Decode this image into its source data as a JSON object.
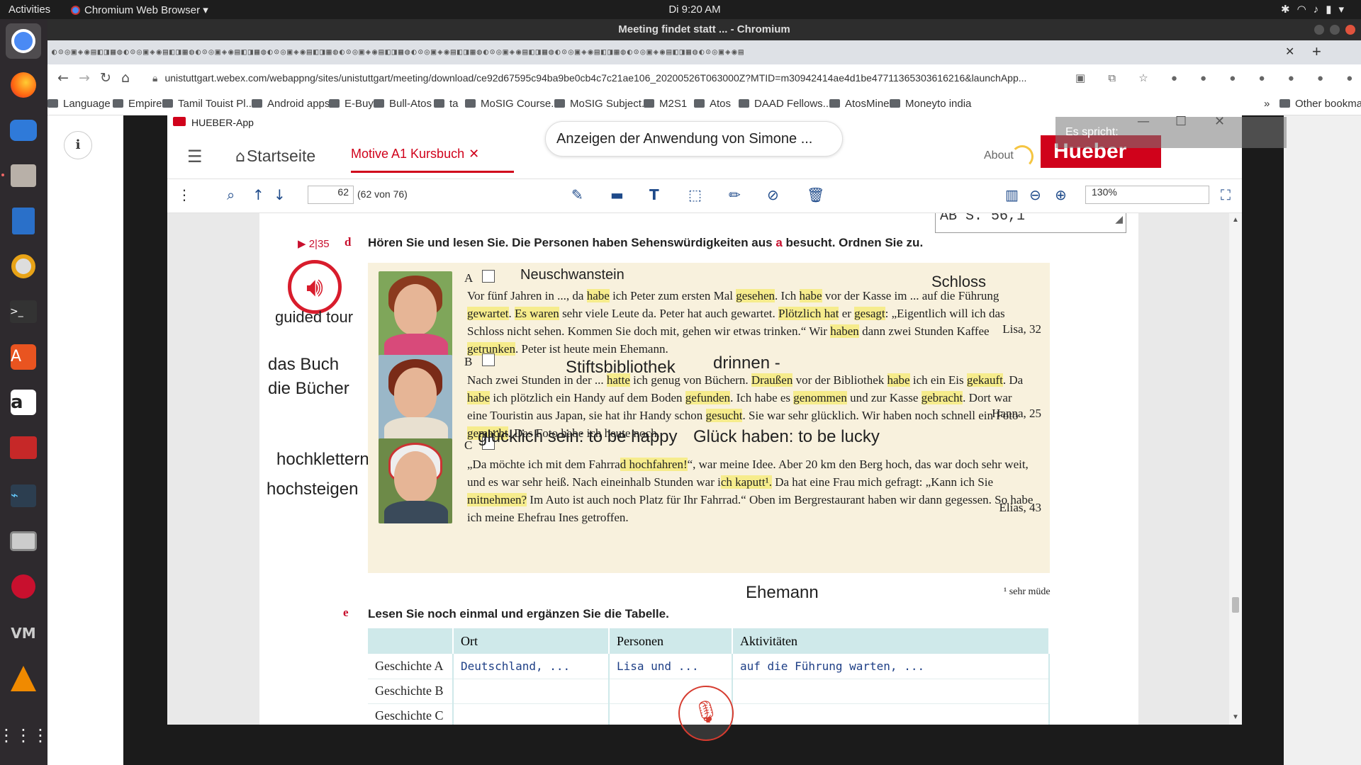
{
  "system": {
    "activities": "Activities",
    "app_menu": "Chromium Web Browser",
    "clock": "Di  9:20 AM"
  },
  "browser": {
    "window_title": "Meeting findet statt ... - Chromium",
    "url": "unistuttgart.webex.com/webappng/sites/unistuttgart/meeting/download/ce92d67595c94ba9be0cb4c7c21ae106_20200526T063000Z?MTID=m30942414ae4d1be47711365303616216&launchApp...",
    "bookmarks": [
      "Language",
      "Empire",
      "Tamil Touist Pl...",
      "Android apps",
      "E-Buy",
      "Bull-Atos",
      "ta",
      "MoSIG Course...",
      "MoSIG Subject...",
      "M2S1",
      "Atos",
      "DAAD Fellows...",
      "AtosMine",
      "Moneyto india"
    ],
    "bookmarks_more": "»",
    "other_bookmarks": "Other bookmarks"
  },
  "webex": {
    "share_banner": "Anzeigen der Anwendung von Simone ...",
    "speaking": "Es spricht:"
  },
  "app": {
    "title": "HUEBER-App",
    "home_tab": "Startseite",
    "book_tab": "Motive A1 Kursbuch",
    "about": "About",
    "brand": "Hueber",
    "page_current": "62",
    "page_total": "(62 von 76)",
    "zoom": "130%"
  },
  "pdf": {
    "ab_ref": "AB S. 56,1",
    "track": "▶ 2|35",
    "section_d": "d",
    "instruction_d_pre": "Hören Sie und lesen Sie. Die Personen haben Sehenswürdigkeiten aus ",
    "instruction_d_a": "a",
    "instruction_d_post": " besucht. Ordnen Sie zu.",
    "annotations": {
      "guided_tour": "guided tour",
      "das_buch": "das Buch",
      "die_buecher": "die Bücher",
      "hochklettern": "hochklettern",
      "hochsteigen": "hochsteigen",
      "neuschwanstein": "Neuschwanstein",
      "schloss": "Schloss",
      "stiftsbibliothek": "Stiftsbibliothek",
      "drinnen": "drinnen -",
      "gluecklich": "glücklich sein: to be happy",
      "glueck": "Glück haben: to be lucky",
      "ehemann": "Ehemann"
    },
    "stories": [
      {
        "letter": "A",
        "signature": "Lisa, 32"
      },
      {
        "letter": "B",
        "signature": "Hanna, 25"
      },
      {
        "letter": "C",
        "signature": "Elias, 43"
      }
    ],
    "footnote": "¹ sehr müde",
    "section_e": "e",
    "instruction_e": "Lesen Sie noch einmal und ergänzen Sie die Tabelle.",
    "table": {
      "headers": [
        "",
        "Ort",
        "Personen",
        "Aktivitäten"
      ],
      "rows": [
        [
          "Geschichte A",
          "Deutschland, ...",
          "Lisa und ...",
          "auf die Führung warten, ..."
        ],
        [
          "Geschichte B",
          "",
          "",
          ""
        ],
        [
          "Geschichte C",
          "",
          "",
          ""
        ]
      ]
    }
  }
}
